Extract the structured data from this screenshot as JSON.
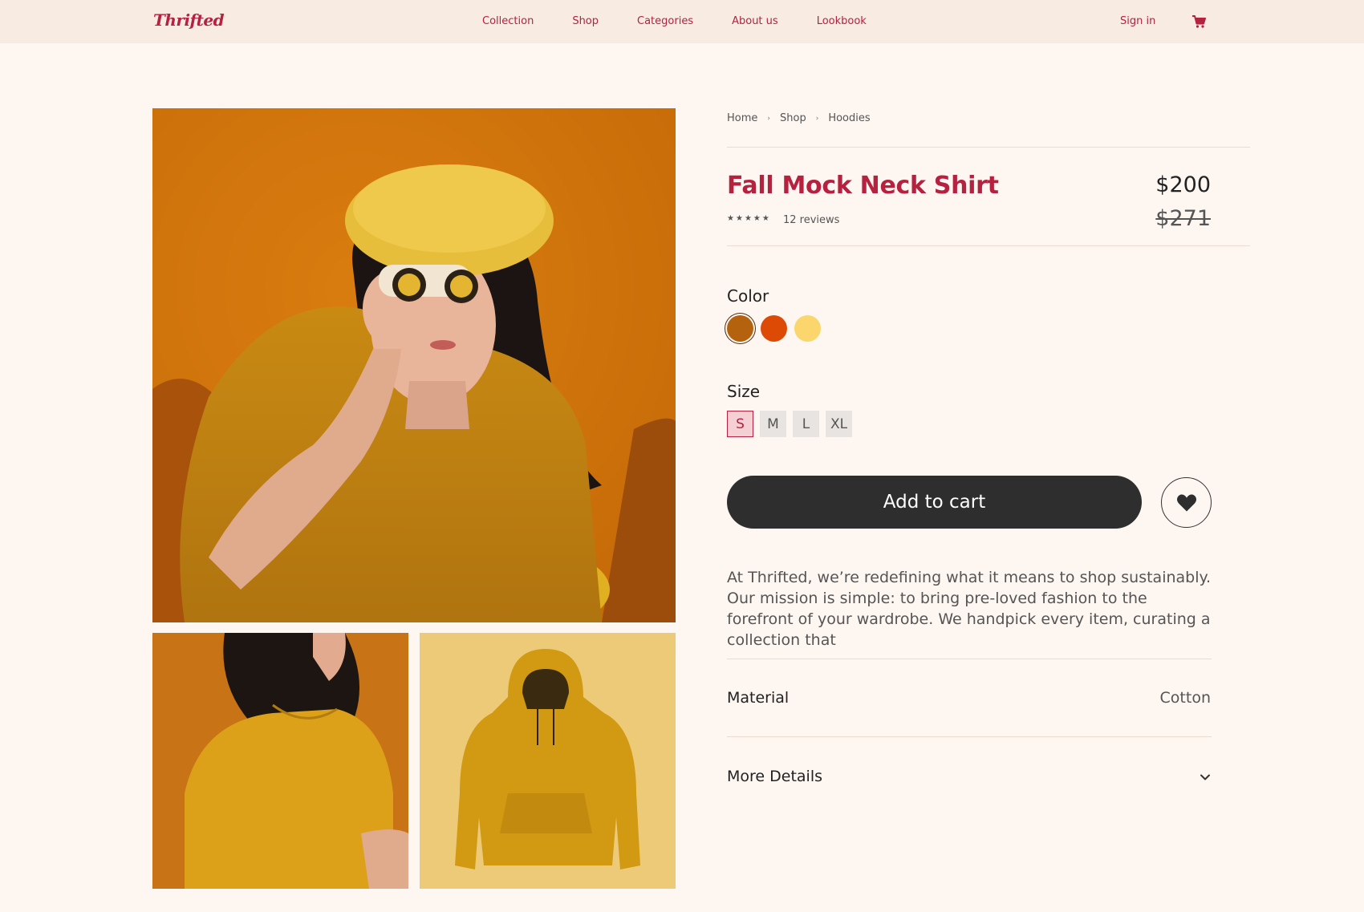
{
  "header": {
    "logo": "Thrifted",
    "nav": [
      "Collection",
      "Shop",
      "Categories",
      "About us",
      "Lookbook"
    ],
    "sign_in": "Sign in",
    "cart_icon": "cart-icon"
  },
  "breadcrumb": [
    "Home",
    "Shop",
    "Hoodies"
  ],
  "product": {
    "title": "Fall Mock Neck Shirt",
    "price": "$200",
    "original_price": "$271",
    "rating": 5,
    "reviews": "12 reviews"
  },
  "color": {
    "label": "Color",
    "options": [
      "#b5620f",
      "#dd4a06",
      "#fbd66d"
    ],
    "selected_index": 0
  },
  "size": {
    "label": "Size",
    "options": [
      "S",
      "M",
      "L",
      "XL"
    ],
    "selected": "S"
  },
  "actions": {
    "add_to_cart": "Add to cart",
    "wishlist_icon": "heart-icon"
  },
  "description": "At Thrifted, we’re redefining what it means to shop sustainably. Our mission is simple: to bring pre-loved fashion to the forefront of your wardrobe. We handpick every item, curating a collection that",
  "details": {
    "material_label": "Material",
    "material_value": "Cotton",
    "more_label": "More Details"
  },
  "colors": {
    "brand": "#b5213f",
    "header_bg": "#f8ebe2",
    "page_bg": "#fdf6f1",
    "button_dark": "#2e2e2e"
  }
}
